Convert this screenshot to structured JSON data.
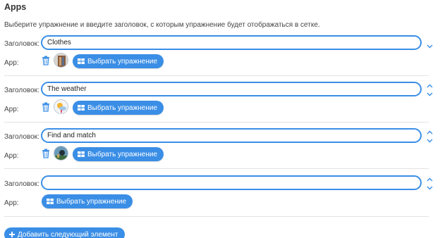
{
  "header": {
    "title": "Apps",
    "description": "Выберите упражнение и введите заголовок, с которым упражнение будет отображаться в сетке."
  },
  "labels": {
    "title_label": "Заголовок:",
    "app_label": "App:"
  },
  "items": [
    {
      "title_value": "Clothes",
      "select_label": "Выбрать упражнение",
      "has_app": true,
      "thumb_icon": "clothes-thumbnail"
    },
    {
      "title_value": "The weather",
      "select_label": "Выбрать упражнение",
      "has_app": true,
      "thumb_icon": "weather-thumbnail"
    },
    {
      "title_value": "Find and match",
      "select_label": "Выбрать упражнение",
      "has_app": true,
      "thumb_icon": "find-match-thumbnail"
    },
    {
      "title_value": "",
      "select_label": "Выбрать упражнение",
      "has_app": false
    }
  ],
  "footer": {
    "add_label": "Добавить следующий элемент"
  },
  "colors": {
    "accent": "#3a8ee6",
    "divider": "#e3e3e3"
  }
}
